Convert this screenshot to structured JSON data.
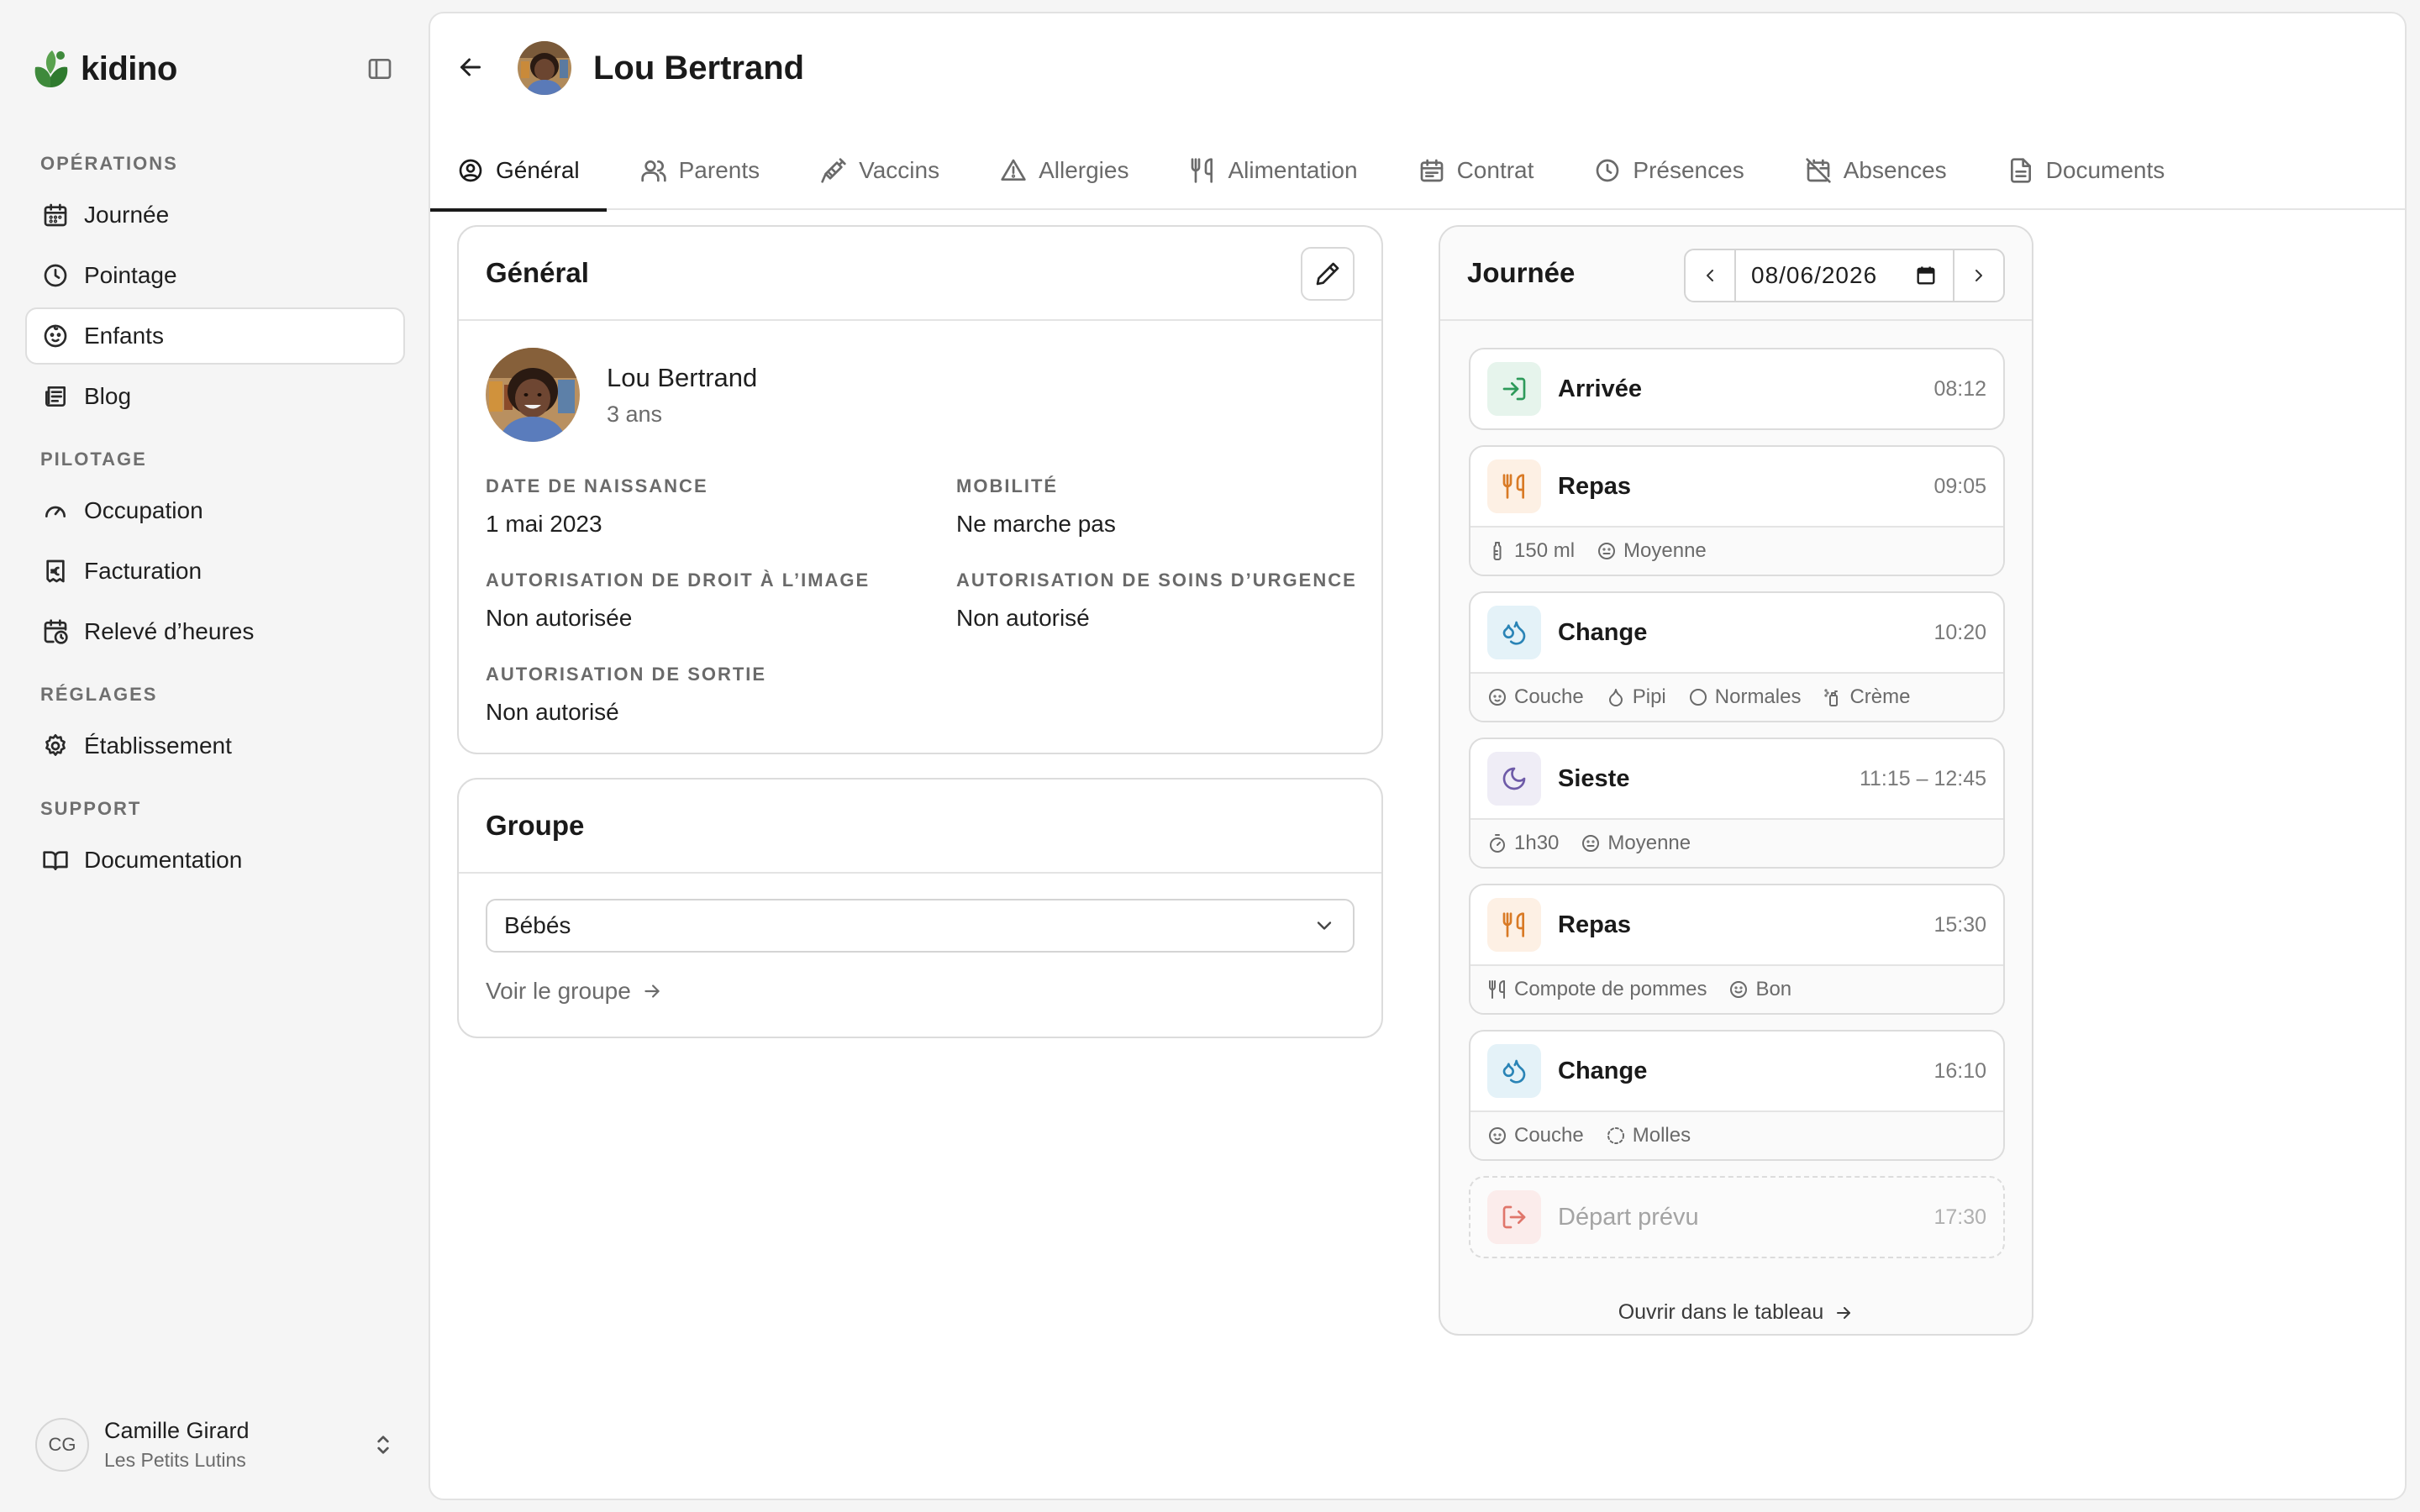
{
  "brand": {
    "name": "kidino",
    "color": "#3f8a3c"
  },
  "sidebar": {
    "sections": [
      {
        "heading": "OPÉRATIONS",
        "items": [
          {
            "label": "Journée",
            "icon": "calendar-icon"
          },
          {
            "label": "Pointage",
            "icon": "clock-icon"
          },
          {
            "label": "Enfants",
            "icon": "baby-icon",
            "active": true
          },
          {
            "label": "Blog",
            "icon": "newspaper-icon"
          }
        ]
      },
      {
        "heading": "PILOTAGE",
        "items": [
          {
            "label": "Occupation",
            "icon": "gauge-icon"
          },
          {
            "label": "Facturation",
            "icon": "receipt-euro-icon"
          },
          {
            "label": "Relevé d’heures",
            "icon": "calendar-clock-icon"
          }
        ]
      },
      {
        "heading": "RÉGLAGES",
        "items": [
          {
            "label": "Établissement",
            "icon": "gear-icon"
          }
        ]
      },
      {
        "heading": "SUPPORT",
        "items": [
          {
            "label": "Documentation",
            "icon": "book-icon"
          }
        ]
      }
    ],
    "user": {
      "initials": "CG",
      "name": "Camille Girard",
      "org": "Les Petits Lutins"
    }
  },
  "header": {
    "title": "Lou Bertrand"
  },
  "tabs": [
    {
      "label": "Général",
      "icon": "user-circle-icon",
      "active": true
    },
    {
      "label": "Parents",
      "icon": "users-icon"
    },
    {
      "label": "Vaccins",
      "icon": "syringe-icon"
    },
    {
      "label": "Allergies",
      "icon": "warning-icon"
    },
    {
      "label": "Alimentation",
      "icon": "utensils-icon"
    },
    {
      "label": "Contrat",
      "icon": "calendar-icon"
    },
    {
      "label": "Présences",
      "icon": "clock-icon"
    },
    {
      "label": "Absences",
      "icon": "calendar-off-icon"
    },
    {
      "label": "Documents",
      "icon": "file-icon"
    }
  ],
  "general": {
    "title": "Général",
    "child": {
      "name": "Lou Bertrand",
      "age": "3 ans"
    },
    "fields": {
      "birth": {
        "label": "Date de naissance",
        "value": "1 mai 2023"
      },
      "mobility": {
        "label": "Mobilité",
        "value": "Ne marche pas"
      },
      "image_rights": {
        "label": "Autorisation de droit à l’image",
        "value": "Non autorisée"
      },
      "emergency_care": {
        "label": "Autorisation de soins d’urgence",
        "value": "Non autorisé"
      },
      "outing": {
        "label": "Autorisation de sortie",
        "value": "Non autorisé"
      }
    }
  },
  "group": {
    "title": "Groupe",
    "selected": "Bébés",
    "link": "Voir le groupe"
  },
  "day": {
    "title": "Journée",
    "date": "08/06/2026",
    "events": [
      {
        "name": "Arrivée",
        "time": "08:12",
        "icon": "arrival-icon",
        "color": "green",
        "tags": []
      },
      {
        "name": "Repas",
        "time": "09:05",
        "icon": "utensils-icon",
        "color": "orange",
        "tags": [
          {
            "icon": "bottle-icon",
            "text": "150 ml"
          },
          {
            "icon": "face-neutral-icon",
            "text": "Moyenne"
          }
        ]
      },
      {
        "name": "Change",
        "time": "10:20",
        "icon": "droplets-icon",
        "color": "blue",
        "tags": [
          {
            "icon": "baby-icon",
            "text": "Couche"
          },
          {
            "icon": "droplet-icon",
            "text": "Pipi"
          },
          {
            "icon": "circle-icon",
            "text": "Normales"
          },
          {
            "icon": "cream-icon",
            "text": "Crème"
          }
        ]
      },
      {
        "name": "Sieste",
        "time": "11:15 – 12:45",
        "icon": "moon-icon",
        "color": "purple",
        "tags": [
          {
            "icon": "timer-icon",
            "text": "1h30"
          },
          {
            "icon": "face-neutral-icon",
            "text": "Moyenne"
          }
        ]
      },
      {
        "name": "Repas",
        "time": "15:30",
        "icon": "utensils-icon",
        "color": "orange",
        "tags": [
          {
            "icon": "utensils-icon",
            "text": "Compote de pommes"
          },
          {
            "icon": "face-smile-icon",
            "text": "Bon"
          }
        ]
      },
      {
        "name": "Change",
        "time": "16:10",
        "icon": "droplets-icon",
        "color": "blue",
        "tags": [
          {
            "icon": "baby-icon",
            "text": "Couche"
          },
          {
            "icon": "dashed-circle-icon",
            "text": "Molles"
          }
        ]
      },
      {
        "name": "Départ prévu",
        "time": "17:30",
        "icon": "departure-icon",
        "color": "red",
        "planned": true,
        "tags": []
      }
    ],
    "open_link": "Ouvrir dans le tableau"
  }
}
